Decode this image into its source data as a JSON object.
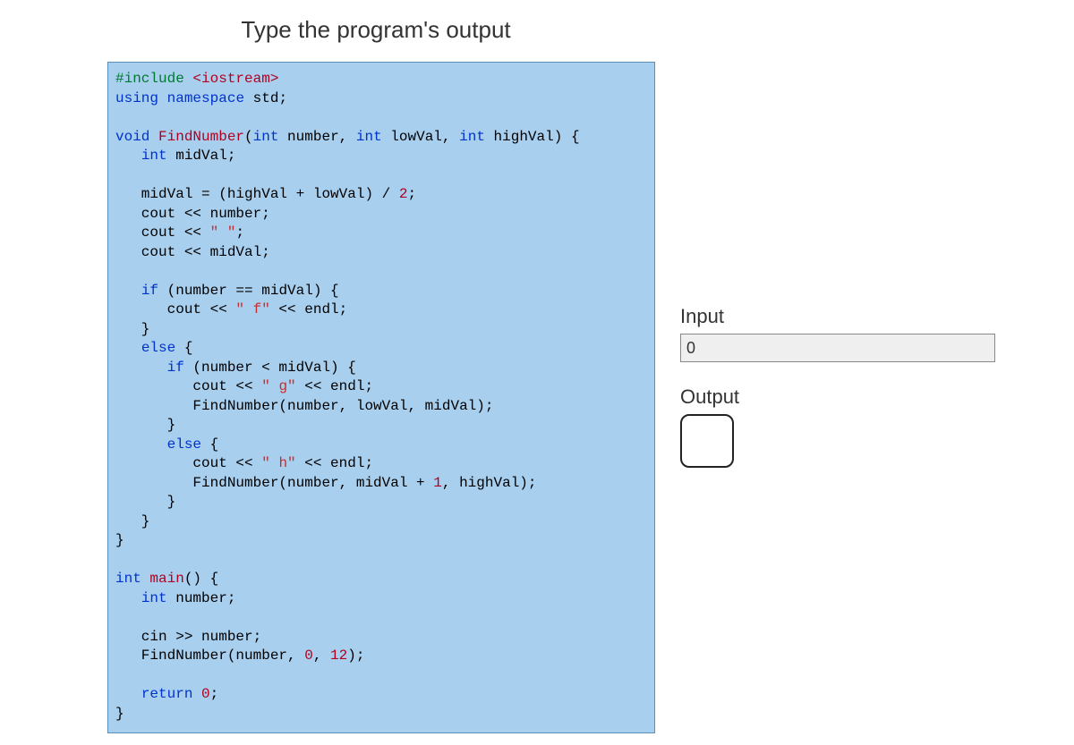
{
  "title": "Type the program's output",
  "code": {
    "l1a": "#include",
    "l1b": " <iostream>",
    "l2a": "using",
    "l2b": " ",
    "l2c": "namespace",
    "l2d": " std;",
    "l3": "",
    "l4a": "void",
    "l4b": " ",
    "l4c": "FindNumber",
    "l4d": "(",
    "l4e": "int",
    "l4f": " number, ",
    "l4g": "int",
    "l4h": " lowVal, ",
    "l4i": "int",
    "l4j": " highVal) {",
    "l5a": "   ",
    "l5b": "int",
    "l5c": " midVal;",
    "l6": "",
    "l7a": "   midVal = (highVal + lowVal) / ",
    "l7b": "2",
    "l7c": ";",
    "l8": "   cout << number;",
    "l9a": "   cout << ",
    "l9b": "\" \"",
    "l9c": ";",
    "l10": "   cout << midVal;",
    "l11": "",
    "l12a": "   ",
    "l12b": "if",
    "l12c": " (number == midVal) {",
    "l13a": "      cout << ",
    "l13b": "\" f\"",
    "l13c": " << endl;",
    "l14": "   }",
    "l15a": "   ",
    "l15b": "else",
    "l15c": " {",
    "l16a": "      ",
    "l16b": "if",
    "l16c": " (number < midVal) {",
    "l17a": "         cout << ",
    "l17b": "\" g\"",
    "l17c": " << endl;",
    "l18": "         FindNumber(number, lowVal, midVal);",
    "l19": "      }",
    "l20a": "      ",
    "l20b": "else",
    "l20c": " {",
    "l21a": "         cout << ",
    "l21b": "\" h\"",
    "l21c": " << endl;",
    "l22a": "         FindNumber(number, midVal + ",
    "l22b": "1",
    "l22c": ", highVal);",
    "l23": "      }",
    "l24": "   }",
    "l25": "}",
    "l26": "",
    "l27a": "int",
    "l27b": " ",
    "l27c": "main",
    "l27d": "() {",
    "l28a": "   ",
    "l28b": "int",
    "l28c": " number;",
    "l29": "",
    "l30": "   cin >> number;",
    "l31a": "   FindNumber(number, ",
    "l31b": "0",
    "l31c": ", ",
    "l31d": "12",
    "l31e": ");",
    "l32": "",
    "l33a": "   ",
    "l33b": "return",
    "l33c": " ",
    "l33d": "0",
    "l33e": ";",
    "l34": "}"
  },
  "io": {
    "input_label": "Input",
    "input_value": "0",
    "output_label": "Output",
    "output_value": ""
  }
}
